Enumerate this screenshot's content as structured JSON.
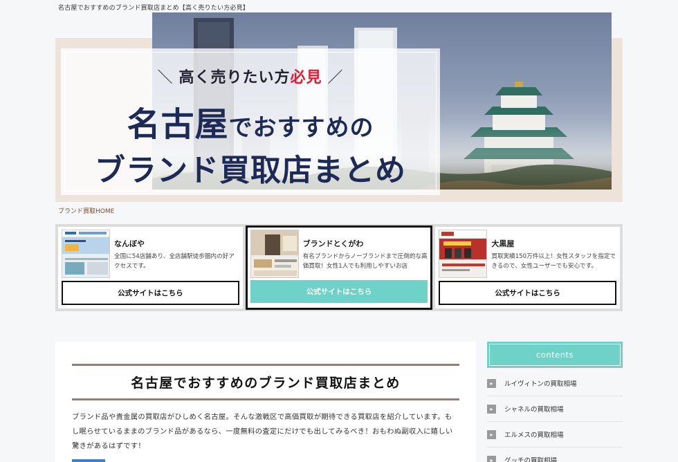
{
  "site": {
    "tagline": "名古屋でおすすめのブランド買取店まとめ【高く売りたい方必見】"
  },
  "hero": {
    "sub_prefix": "高く売りたい方",
    "sub_highlight": "必見",
    "title_line1_big": "名古屋",
    "title_line1_rest": "でおすすめの",
    "title_line2": "ブランド買取店まとめ",
    "colors": {
      "navy": "#1d2a55",
      "accent_red": "#e21c32",
      "marker_yellow": "#f6e76a",
      "beige": "#ede3d9"
    }
  },
  "breadcrumb": {
    "home": "ブランド買取HOME"
  },
  "shops": [
    {
      "name": "なんぼや",
      "description": "全国に54店舗あり、全店舗駅徒歩圏内の好アクセスです。",
      "button": "公式サイトはこちら",
      "featured": false
    },
    {
      "name": "ブランドとくがわ",
      "description": "有名ブランドからノーブランドまで圧倒的な高価買取！女性1人でも利用しやすいお店",
      "button": "公式サイトはこちら",
      "featured": true
    },
    {
      "name": "大黒屋",
      "description": "買取実績150万件以上！女性スタッフを指定できるので、女性ユーザーでも安心です。",
      "button": "公式サイトはこちら",
      "featured": false
    }
  ],
  "article": {
    "title": "名古屋でおすすめのブランド買取店まとめ",
    "body": "ブランド品や貴金属の買取店がひしめく名古屋。そんな激戦区で高価買取が期待できる買取店を紹介しています。もし眠らせているままのブランド品があるなら、一度無料の査定にだけでも出してみるべき！おもわぬ副収入に嬉しい驚きがあるはずです！"
  },
  "sidebar": {
    "heading": "contents",
    "items": [
      {
        "label": "ルイヴィトンの買取相場",
        "icon": "chevron-right-icon"
      },
      {
        "label": "シャネルの買取相場",
        "icon": "chevron-right-icon"
      },
      {
        "label": "エルメスの買取相場",
        "icon": "chevron-right-icon"
      },
      {
        "label": "グッチの買取相場",
        "icon": "chevron-right-icon"
      }
    ],
    "accent": "#6fd2c8"
  }
}
